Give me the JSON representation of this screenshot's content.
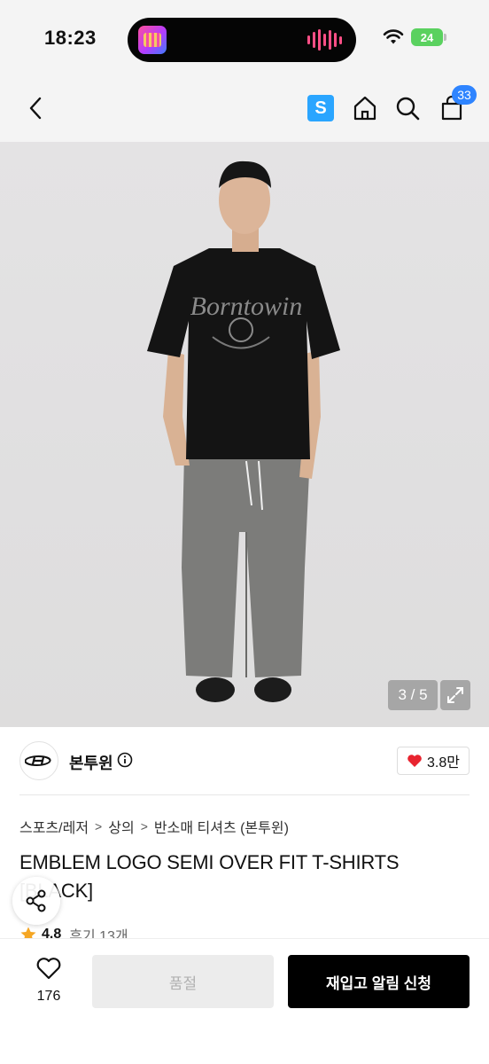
{
  "status_bar": {
    "time": "18:23",
    "battery": "24"
  },
  "header": {
    "cart_count": "33",
    "s_label": "S"
  },
  "image": {
    "counter": "3 / 5"
  },
  "brand": {
    "name": "본투윈",
    "likes": "3.8만"
  },
  "breadcrumb": [
    "스포츠/레저",
    "상의",
    "반소매 티셔츠 (본투윈)"
  ],
  "product": {
    "title": "EMBLEM LOGO SEMI OVER FIT T-SHIRTS [BLACK]",
    "rating": "4.8",
    "reviews": "후기 13개"
  },
  "bottom_bar": {
    "wish_count": "176",
    "soldout_label": "품절",
    "restock_label": "재입고 알림 신청"
  },
  "colors": {
    "accent_blue": "#2e84ff",
    "s_badge": "#2aa5ff",
    "heart_red": "#e8242f",
    "star": "#f5a623"
  }
}
